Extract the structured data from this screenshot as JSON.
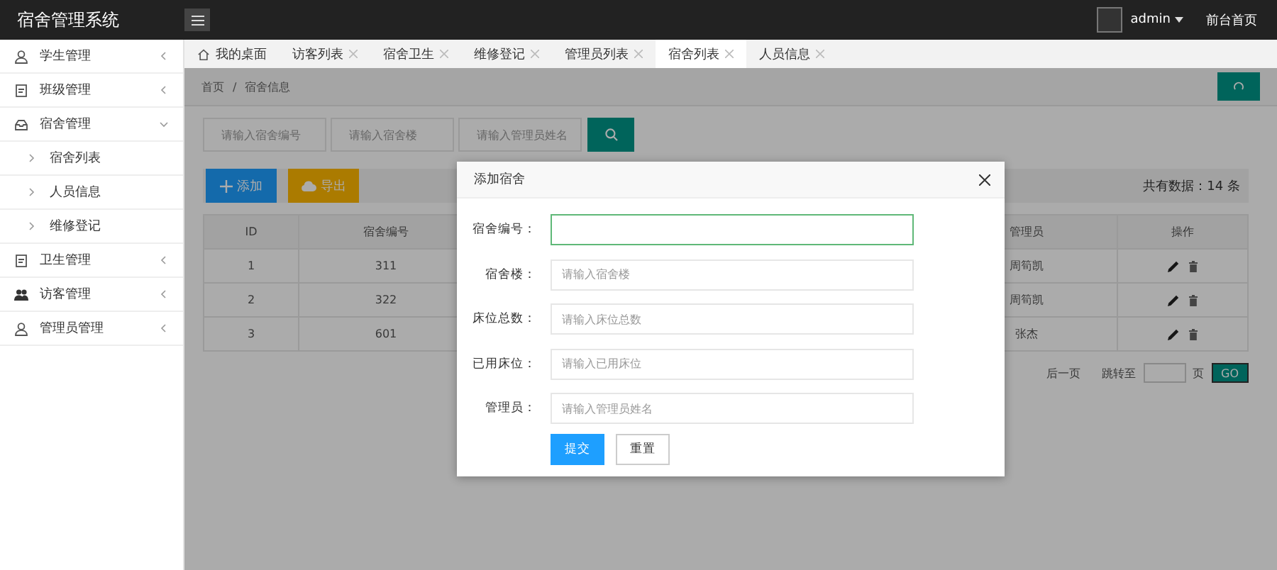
{
  "header": {
    "title": "宿舍管理系统",
    "user": "admin",
    "home_link": "前台首页"
  },
  "sidebar": {
    "items": [
      {
        "label": "学生管理",
        "kind": "user",
        "expanded": false
      },
      {
        "label": "班级管理",
        "kind": "doc",
        "expanded": false
      },
      {
        "label": "宿舍管理",
        "kind": "tray",
        "expanded": true,
        "children": [
          {
            "label": "宿舍列表"
          },
          {
            "label": "人员信息"
          },
          {
            "label": "维修登记"
          }
        ]
      },
      {
        "label": "卫生管理",
        "kind": "doc",
        "expanded": false
      },
      {
        "label": "访客管理",
        "kind": "users",
        "expanded": false
      },
      {
        "label": "管理员管理",
        "kind": "user",
        "expanded": false
      }
    ]
  },
  "tabs": [
    {
      "label": "我的桌面",
      "kind": "home",
      "selected": false
    },
    {
      "label": "访客列表",
      "kind": "closable",
      "selected": false
    },
    {
      "label": "宿舍卫生",
      "kind": "closable",
      "selected": false
    },
    {
      "label": "维修登记",
      "kind": "closable",
      "selected": false
    },
    {
      "label": "管理员列表",
      "kind": "closable",
      "selected": false
    },
    {
      "label": "宿舍列表",
      "kind": "closable",
      "selected": true
    },
    {
      "label": "人员信息",
      "kind": "closable",
      "selected": false
    }
  ],
  "breadcrumb": {
    "separator": "/",
    "items": [
      "首页",
      "宿舍信息"
    ]
  },
  "search": {
    "fields": [
      {
        "placeholder": "请输入宿舍编号"
      },
      {
        "placeholder": "请输入宿舍楼"
      },
      {
        "placeholder": "请输入管理员姓名"
      }
    ]
  },
  "toolbar": {
    "add": "添加",
    "export": "导出",
    "total": "共有数据：14 条"
  },
  "table": {
    "columns": [
      "ID",
      "宿舍编号",
      "管理员",
      "操作"
    ],
    "rows": [
      {
        "id": "1",
        "number": "311",
        "manager": "周筍凯"
      },
      {
        "id": "2",
        "number": "322",
        "manager": "周筍凯"
      },
      {
        "id": "3",
        "number": "601",
        "manager": "张杰"
      }
    ]
  },
  "pagination": {
    "next": "后一页",
    "jump_label": "跳转至",
    "page_unit": "页",
    "go": "GO"
  },
  "modal": {
    "title": "添加宿舍",
    "fields": [
      {
        "label": "宿舍编号：",
        "focused": true
      },
      {
        "label": "宿舍楼：",
        "placeholder": "请输入宿舍楼",
        "focused": false
      },
      {
        "label": "床位总数：",
        "placeholder": "请输入床位总数",
        "focused": false
      },
      {
        "label": "已用床位：",
        "placeholder": "请输入已用床位",
        "focused": false
      },
      {
        "label": "管理员：",
        "placeholder": "请输入管理员姓名",
        "focused": false
      }
    ],
    "submit": "提交",
    "reset": "重置"
  }
}
